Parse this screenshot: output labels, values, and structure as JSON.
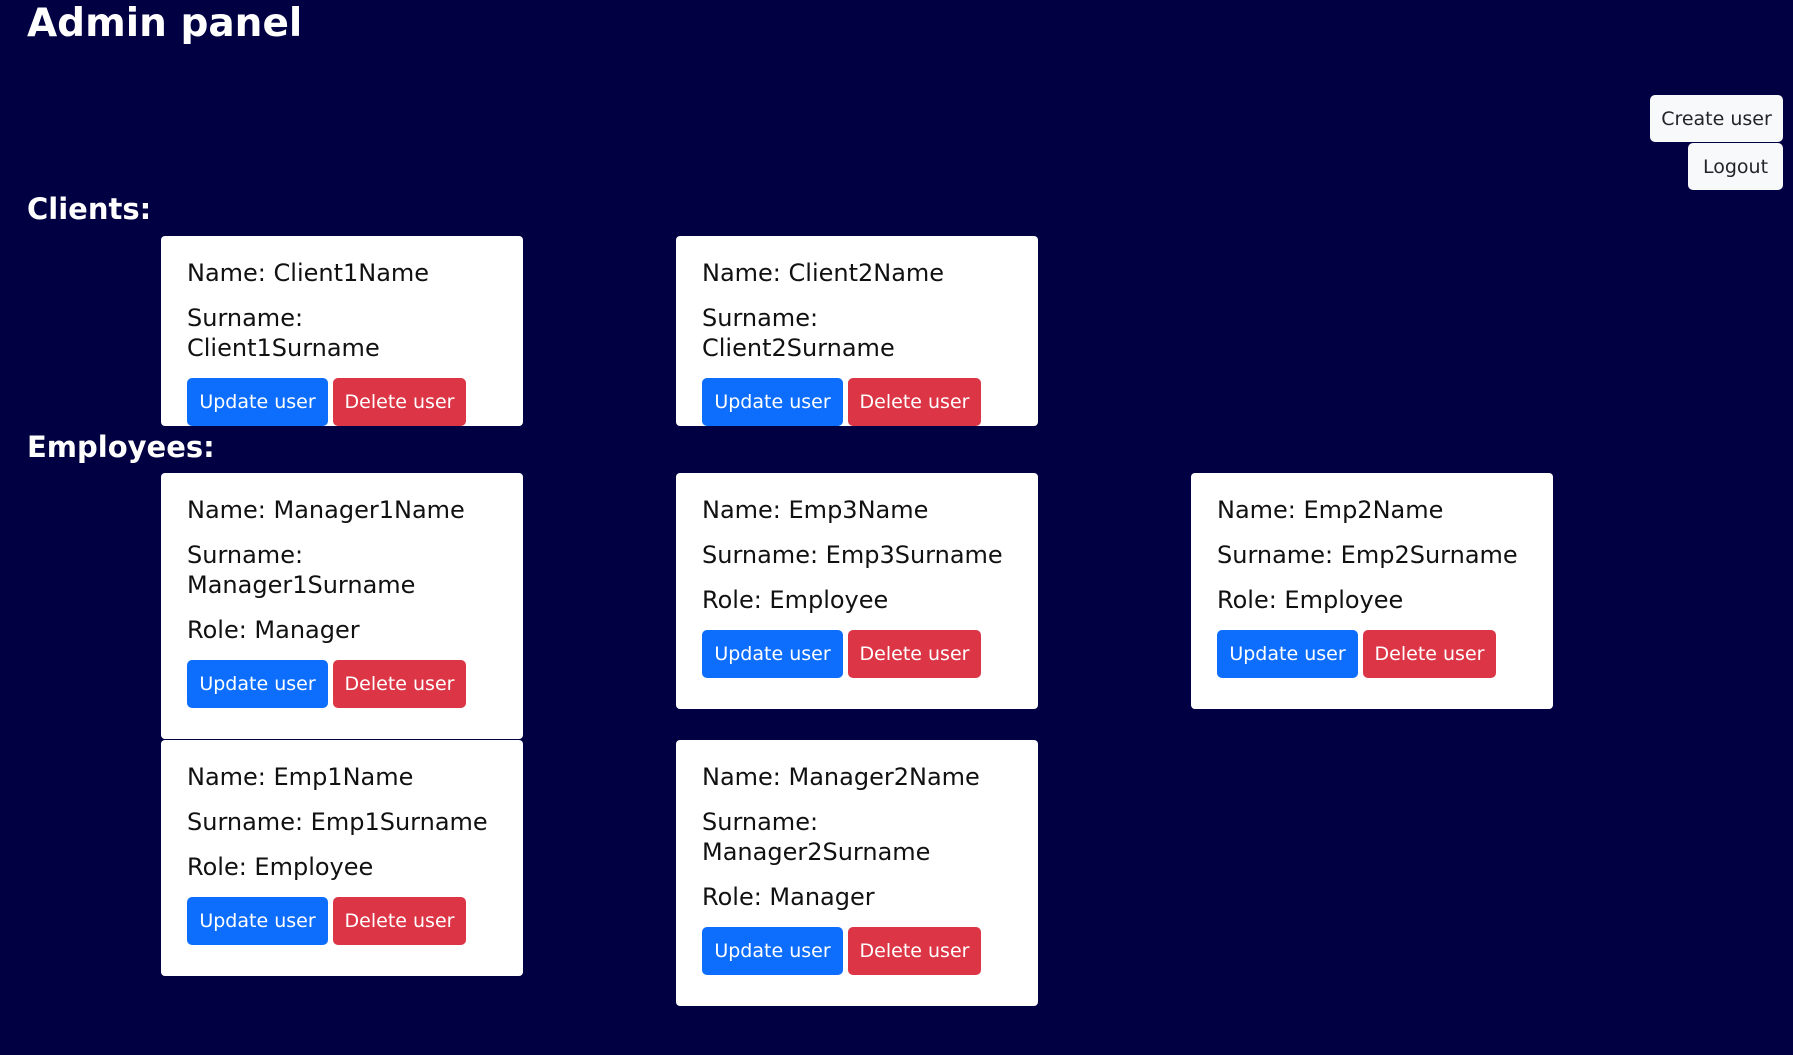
{
  "header": {
    "title": "Admin panel",
    "create_label": "Create user",
    "logout_label": "Logout"
  },
  "clients": {
    "title": "Clients:",
    "items": [
      {
        "name_text": "Name: Client1Name",
        "surname_text": "Surname: Client1Surname"
      },
      {
        "name_text": "Name: Client2Name",
        "surname_text": "Surname: Client2Surname"
      }
    ]
  },
  "employees": {
    "title": "Employees:",
    "items": [
      {
        "name_text": "Name: Manager1Name",
        "surname_text": "Surname: Manager1Surname",
        "role_text": "Role: Manager"
      },
      {
        "name_text": "Name: Emp3Name",
        "surname_text": "Surname: Emp3Surname",
        "role_text": "Role: Employee"
      },
      {
        "name_text": "Name: Emp2Name",
        "surname_text": "Surname: Emp2Surname",
        "role_text": "Role: Employee"
      },
      {
        "name_text": "Name: Emp1Name",
        "surname_text": "Surname: Emp1Surname",
        "role_text": "Role: Employee"
      },
      {
        "name_text": "Name: Manager2Name",
        "surname_text": "Surname: Manager2Surname",
        "role_text": "Role: Manager"
      }
    ]
  },
  "card_actions": {
    "update_label": "Update user",
    "delete_label": "Delete user"
  },
  "colors": {
    "background": "#000043",
    "update": "#0d6efd",
    "delete": "#dc3545",
    "light_button": "#f8f9fa"
  }
}
